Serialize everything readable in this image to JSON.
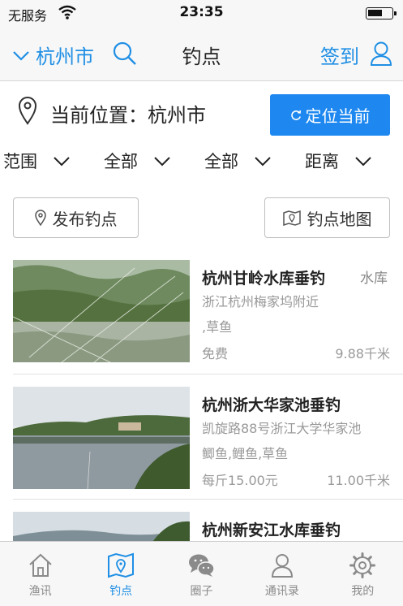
{
  "status_bar": {
    "carrier": "无服务",
    "time": "23:35"
  },
  "navbar": {
    "city": "杭州市",
    "title": "钓点",
    "checkin": "签到"
  },
  "location": {
    "label": "当前位置：杭州市",
    "button": "定位当前"
  },
  "filters": [
    "范围",
    "全部",
    "全部",
    "距离"
  ],
  "actions": {
    "publish": "发布钓点",
    "map": "钓点地图"
  },
  "spots": [
    {
      "name": "杭州甘岭水库垂钓",
      "tag": "水库",
      "address": "浙江杭州梅家坞附近",
      "fish": ",草鱼",
      "price": "免费",
      "distance": "9.88千米"
    },
    {
      "name": "杭州浙大华家池垂钓",
      "tag": "",
      "address": "凯旋路88号浙江大学华家池",
      "fish": "鲫鱼,鲤鱼,草鱼",
      "price": "每斤15.00元",
      "distance": "11.00千米"
    },
    {
      "name": "杭州新安江水库垂钓",
      "tag": "",
      "address": "",
      "fish": "",
      "price": "",
      "distance": ""
    }
  ],
  "tabs": [
    {
      "label": "渔讯",
      "icon": "home-icon"
    },
    {
      "label": "钓点",
      "icon": "map-pin-icon",
      "active": true
    },
    {
      "label": "圈子",
      "icon": "chat-icon"
    },
    {
      "label": "通讯录",
      "icon": "contacts-icon"
    },
    {
      "label": "我的",
      "icon": "gear-icon"
    }
  ],
  "colors": {
    "accent": "#1f8fe5",
    "button": "#1e88f0",
    "muted_text": "#999999"
  }
}
